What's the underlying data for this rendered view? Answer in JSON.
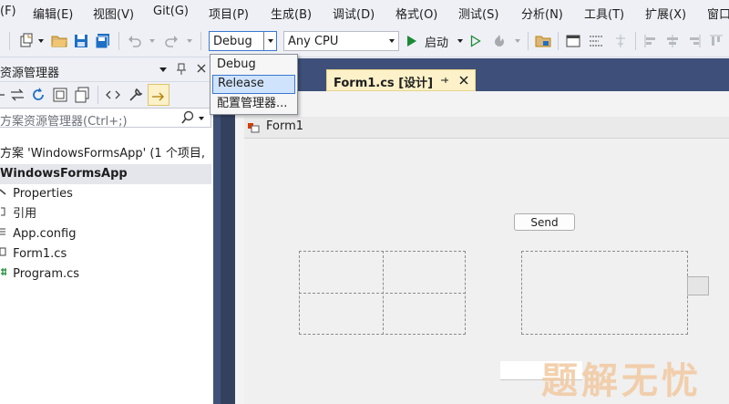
{
  "menubar": {
    "items": [
      "(F)",
      "编辑(E)",
      "视图(V)",
      "Git(G)",
      "项目(P)",
      "生成(B)",
      "调试(D)",
      "格式(O)",
      "测试(S)",
      "分析(N)",
      "工具(T)",
      "扩展(X)",
      "窗口"
    ]
  },
  "toolbar": {
    "config_value": "Debug",
    "platform_value": "Any CPU",
    "start_label": "启动"
  },
  "config_dropdown": {
    "options": [
      "Debug",
      "Release",
      "配置管理器..."
    ],
    "selected": "Release"
  },
  "solution_explorer": {
    "title": "资源管理器",
    "search_placeholder": "方案资源管理器(Ctrl+;)",
    "solution_label": "方案 'WindowsFormsApp' (1 个项目,",
    "project_label": "WindowsFormsApp",
    "items": [
      "Properties",
      "引用",
      "App.config",
      "Form1.cs",
      "Program.cs"
    ]
  },
  "document_tab": {
    "label": "Form1.cs [设计]"
  },
  "designer": {
    "form_title": "Form1",
    "send_button_label": "Send"
  },
  "watermark": "题解无忧",
  "colors": {
    "accent_blue": "#3e5079",
    "tab_active": "#fcf1c8",
    "selection": "#cfe3fc"
  }
}
